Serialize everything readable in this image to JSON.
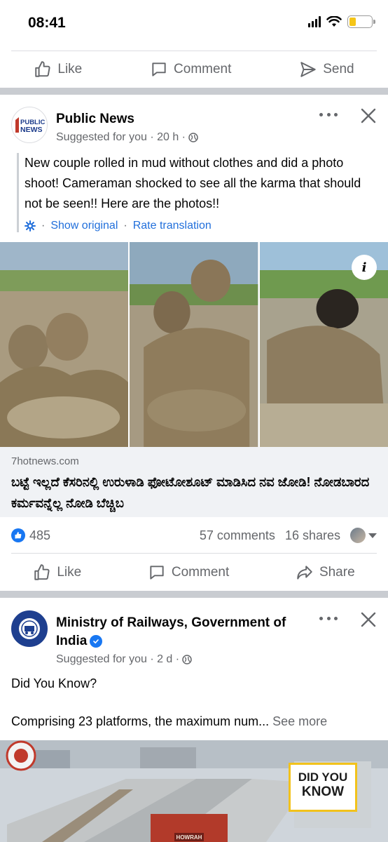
{
  "status_bar": {
    "time": "08:41"
  },
  "top_actions": {
    "like": "Like",
    "comment": "Comment",
    "send": "Send"
  },
  "post1": {
    "page_name": "Public News",
    "logo_text_top": "PUBLIC",
    "logo_text_bottom": "NEWS",
    "meta": "Suggested for you · 20 h ·",
    "text": "New couple rolled in mud without clothes and did a photo shoot! Cameraman shocked to see all the karma that should not be seen!! Here are the photos!!",
    "show_original": "Show original",
    "rate_translation": "Rate translation",
    "separator": "·",
    "info_label": "i",
    "link_domain": "7hotnews.com",
    "link_title": "ಬಟ್ಟೆ ಇಲ್ಲದೆ ಕೆಸರಿನಲ್ಲಿ ಉರುಳಾಡಿ ಫೋಟೋಶೂಟ್ ಮಾಡಿಸಿದ ನವ ಜೋಡಿ! ನೋಡಬಾರದ ಕರ್ಮವನ್ನೆಲ್ಲ ನೋಡಿ ಬೆಚ್ಚಿಬ",
    "reactions": "485",
    "comments": "57 comments",
    "shares": "16 shares",
    "actions": {
      "like": "Like",
      "comment": "Comment",
      "share": "Share"
    }
  },
  "post2": {
    "page_name_line1": "Ministry of Railways, Government of",
    "page_name_line2": "India",
    "meta": "Suggested for you · 2 d ·",
    "text_line1": "Did You Know?",
    "text_line2": "Comprising 23 platforms, the maximum num...",
    "see_more": "See more",
    "badge_line1": "DID YOU",
    "badge_line2": "KNOW",
    "sign_text": "HOWRAH"
  },
  "colors": {
    "accent": "#1877f2",
    "link_blue": "#216fdb",
    "secondary_text": "#65676b",
    "section_gap": "#c9ccd1",
    "battery": "#f5c518"
  },
  "battery_level": 0.3
}
